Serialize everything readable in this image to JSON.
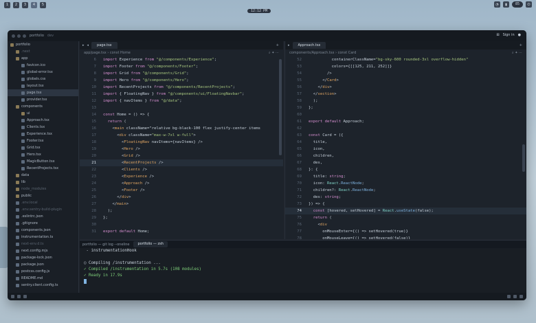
{
  "topbar": {
    "workspaces": [
      "1",
      "2",
      "3",
      "4",
      "5"
    ],
    "active_workspace": "4",
    "clock": "12:12 PM",
    "right_indicator": "85"
  },
  "window": {
    "project": "portfolio",
    "project_sub": "dev",
    "sign_in": "Sign in"
  },
  "sidebar": {
    "items": [
      {
        "label": "portfolio",
        "type": "dir",
        "indent": 0
      },
      {
        "label": ".next",
        "type": "dir",
        "indent": 1,
        "dim": true
      },
      {
        "label": "app",
        "type": "dir",
        "indent": 1
      },
      {
        "label": "favicon.ico",
        "type": "file",
        "indent": 2
      },
      {
        "label": "global-error.tsx",
        "type": "file",
        "indent": 2
      },
      {
        "label": "globals.css",
        "type": "file",
        "indent": 2
      },
      {
        "label": "layout.tsx",
        "type": "file",
        "indent": 2
      },
      {
        "label": "page.tsx",
        "type": "file",
        "indent": 2,
        "selected": true
      },
      {
        "label": "provider.tsx",
        "type": "file",
        "indent": 2
      },
      {
        "label": "components",
        "type": "dir",
        "indent": 1
      },
      {
        "label": "ui",
        "type": "dir",
        "indent": 2
      },
      {
        "label": "Approach.tsx",
        "type": "file",
        "indent": 2
      },
      {
        "label": "Clients.tsx",
        "type": "file",
        "indent": 2
      },
      {
        "label": "Experience.tsx",
        "type": "file",
        "indent": 2
      },
      {
        "label": "Footer.tsx",
        "type": "file",
        "indent": 2
      },
      {
        "label": "Grid.tsx",
        "type": "file",
        "indent": 2
      },
      {
        "label": "Hero.tsx",
        "type": "file",
        "indent": 2
      },
      {
        "label": "MagicButton.tsx",
        "type": "file",
        "indent": 2
      },
      {
        "label": "RecentProjects.tsx",
        "type": "file",
        "indent": 2
      },
      {
        "label": "data",
        "type": "dir",
        "indent": 1
      },
      {
        "label": "lib",
        "type": "dir",
        "indent": 1
      },
      {
        "label": "node_modules",
        "type": "dir",
        "indent": 1,
        "dim": true
      },
      {
        "label": "public",
        "type": "dir",
        "indent": 1
      },
      {
        "label": ".env.local",
        "type": "file",
        "indent": 1,
        "dim": true
      },
      {
        "label": ".env.sentry-build-plugin",
        "type": "file",
        "indent": 1,
        "dim": true
      },
      {
        "label": ".eslintrc.json",
        "type": "file",
        "indent": 1
      },
      {
        "label": ".gitignore",
        "type": "file",
        "indent": 1
      },
      {
        "label": "components.json",
        "type": "file",
        "indent": 1
      },
      {
        "label": "instrumentation.ts",
        "type": "file",
        "indent": 1
      },
      {
        "label": "next-env.d.ts",
        "type": "file",
        "indent": 1,
        "dim": true
      },
      {
        "label": "next.config.mjs",
        "type": "file",
        "indent": 1
      },
      {
        "label": "package-lock.json",
        "type": "file",
        "indent": 1
      },
      {
        "label": "package.json",
        "type": "file",
        "indent": 1
      },
      {
        "label": "postcss.config.js",
        "type": "file",
        "indent": 1
      },
      {
        "label": "README.md",
        "type": "file",
        "indent": 1
      },
      {
        "label": "sentry.client.config.ts",
        "type": "file",
        "indent": 1
      }
    ]
  },
  "left_editor": {
    "tab": "page.tsx",
    "breadcrumb": "app/page.tsx › const Home",
    "current_line": "21",
    "lines": [
      {
        "n": "6",
        "t": "import Experience from \"@/components/Experience\";"
      },
      {
        "n": "7",
        "t": "import Footer from \"@/components/Footer\";"
      },
      {
        "n": "8",
        "t": "import Grid from \"@/components/Grid\";"
      },
      {
        "n": "9",
        "t": "import Hero from \"@/components/Hero\";"
      },
      {
        "n": "10",
        "t": "import RecentProjects from \"@/components/RecentProjects\";"
      },
      {
        "n": "11",
        "t": "import { FloatingNav } from \"@/components/ui/FloatingNavbar\";"
      },
      {
        "n": "12",
        "t": "import { navItems } from \"@/data\";"
      },
      {
        "n": "13",
        "t": ""
      },
      {
        "n": "14",
        "t": "const Home = () => {"
      },
      {
        "n": "15",
        "t": "  return ("
      },
      {
        "n": "16",
        "t": "    <main className=\"relative bg-black-100 flex justify-center items"
      },
      {
        "n": "17",
        "t": "      <div className=\"max-w-7xl w-full\">"
      },
      {
        "n": "18",
        "t": "        <FloatingNav navItems={navItems} />"
      },
      {
        "n": "19",
        "t": "        <Hero />"
      },
      {
        "n": "20",
        "t": "        <Grid />"
      },
      {
        "n": "21",
        "t": "        <RecentProjects />"
      },
      {
        "n": "22",
        "t": "        <Clients />"
      },
      {
        "n": "23",
        "t": "        <Experience />"
      },
      {
        "n": "24",
        "t": "        <Approach />"
      },
      {
        "n": "25",
        "t": "        <Footer />"
      },
      {
        "n": "26",
        "t": "      </div>"
      },
      {
        "n": "27",
        "t": "    </main>"
      },
      {
        "n": "28",
        "t": "  );"
      },
      {
        "n": "29",
        "t": "};"
      },
      {
        "n": "30",
        "t": ""
      },
      {
        "n": "31",
        "t": "export default Home;"
      }
    ]
  },
  "right_editor": {
    "tab": "Approach.tsx",
    "breadcrumb": "components/Approach.tsx › const Card",
    "current_line": "74",
    "lines": [
      {
        "n": "52",
        "t": "          containerClassName=\"bg-sky-600 rounded-3xl overflow-hidden\""
      },
      {
        "n": "53",
        "t": "          colors={[[125, 211, 252]]}"
      },
      {
        "n": "54",
        "t": "        />"
      },
      {
        "n": "55",
        "t": "      </Card>"
      },
      {
        "n": "56",
        "t": "    </div>"
      },
      {
        "n": "57",
        "t": "  </section>"
      },
      {
        "n": "58",
        "t": "  );"
      },
      {
        "n": "59",
        "t": "};"
      },
      {
        "n": "60",
        "t": ""
      },
      {
        "n": "61",
        "t": "export default Approach;"
      },
      {
        "n": "62",
        "t": ""
      },
      {
        "n": "63",
        "t": "const Card = ({"
      },
      {
        "n": "64",
        "t": "  title,"
      },
      {
        "n": "65",
        "t": "  icon,"
      },
      {
        "n": "66",
        "t": "  children,"
      },
      {
        "n": "67",
        "t": "  des,"
      },
      {
        "n": "68",
        "t": "}: {"
      },
      {
        "n": "69",
        "t": "  title: string;"
      },
      {
        "n": "70",
        "t": "  icon: React.ReactNode;"
      },
      {
        "n": "71",
        "t": "  children?: React.ReactNode;"
      },
      {
        "n": "72",
        "t": "  des: string;"
      },
      {
        "n": "73",
        "t": "}) => {"
      },
      {
        "n": "74",
        "t": "  const [hovered, setHovered] = React.useState(false);"
      },
      {
        "n": "75",
        "t": "  return ("
      },
      {
        "n": "76",
        "t": "    <div"
      },
      {
        "n": "77",
        "t": "      onMouseEnter={() => setHovered(true)}"
      },
      {
        "n": "78",
        "t": "      onMouseLeave={() => setHovered(false)}"
      }
    ]
  },
  "terminal": {
    "tabs": [
      "portfolio — git log --oneline",
      "portfolio — zsh"
    ],
    "lines": [
      {
        "t": " - instrumentationHook",
        "ok": false
      },
      {
        "t": "",
        "ok": false
      },
      {
        "t": "○ Compiling /instrumentation ...",
        "ok": false
      },
      {
        "t": "✓ Compiled /instrumentation in 5.7s (108 modules)",
        "ok": true
      },
      {
        "t": "✓ Ready in 17.9s",
        "ok": true
      }
    ]
  },
  "colors": {
    "window_bg": "#1f242c",
    "accent": "#7fb3e0",
    "success": "#7fd07a"
  }
}
